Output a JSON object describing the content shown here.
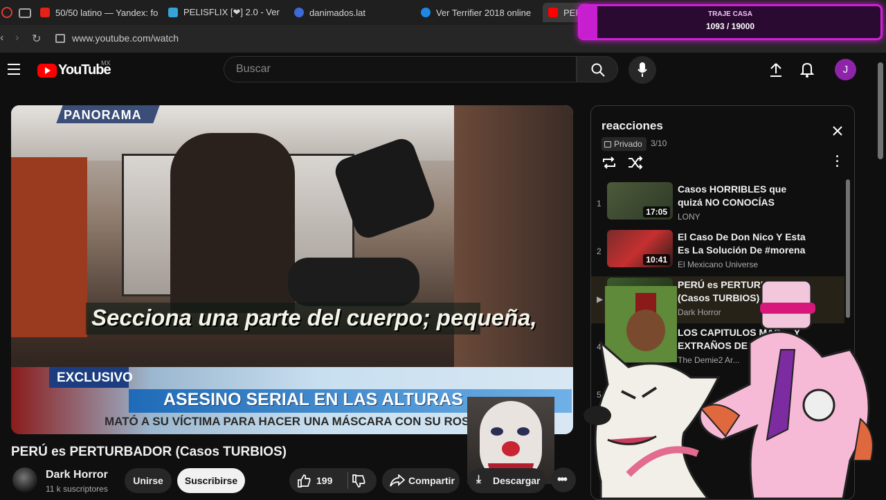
{
  "browser": {
    "tabs": [
      {
        "title": "50/50 latino — Yandex: fo",
        "color": "#e62117"
      },
      {
        "title": "PELISFLIX [❤] 2.0 - Ver I",
        "color": "#36a3d9"
      },
      {
        "title": "danimados.lat",
        "color": "#3d6bd6"
      },
      {
        "title": "Ver Terrifier 2018 online I",
        "color": "#1e88e5"
      },
      {
        "title": "PER",
        "color": "#ff0000"
      }
    ],
    "url": "www.youtube.com/watch"
  },
  "stream_goal": {
    "label": "TRAJE CASA",
    "current": 1093,
    "target": 19000,
    "text": "1093 / 19000"
  },
  "header": {
    "logo_text": "YouTube",
    "region": "MX",
    "search_placeholder": "Buscar",
    "avatar_letter": "J",
    "avatar_color": "#8e24aa"
  },
  "video": {
    "network_logo": "PANORAMA",
    "caption": "Secciona una parte del cuerpo; pequeña,",
    "badge": "EXCLUSIVO",
    "headline": "ASESINO SERIAL EN LAS ALTURAS",
    "subline": "MATÓ A SU VÍCTIMA PARA HACER UNA MÁSCARA CON SU ROSTRO",
    "title": "PERÚ es PERTURBADOR (Casos TURBIOS)"
  },
  "channel": {
    "name": "Dark Horror",
    "subscribers": "11 k suscriptores",
    "join_label": "Unirse",
    "subscribe_label": "Suscribirse"
  },
  "actions": {
    "likes": "199",
    "share_label": "Compartir",
    "download_label": "Descargar"
  },
  "playlist": {
    "title": "reacciones",
    "privacy": "Privado",
    "position": "3/10",
    "items": [
      {
        "index": "1",
        "title": "Casos HORRIBLES que quizá NO CONOCÍAS",
        "channel": "LONY",
        "duration": "17:05"
      },
      {
        "index": "2",
        "title": "El Caso De Don Nico Y Esta Es La Solución De #morena",
        "channel": "El Mexicano Universe",
        "duration": "10:41"
      },
      {
        "index": "▶",
        "title": "PERÚ es PERTURBADOR (Casos TURBIOS)",
        "channel": "Dark Horror",
        "duration": ""
      },
      {
        "index": "4",
        "title": "LOS CAPITULOS MAS ... Y EXTRAÑOS DE MI...",
        "channel": "The Demie2 Ar...",
        "duration": ""
      },
      {
        "index": "5",
        "title": "",
        "channel": "",
        "duration": ""
      }
    ]
  }
}
